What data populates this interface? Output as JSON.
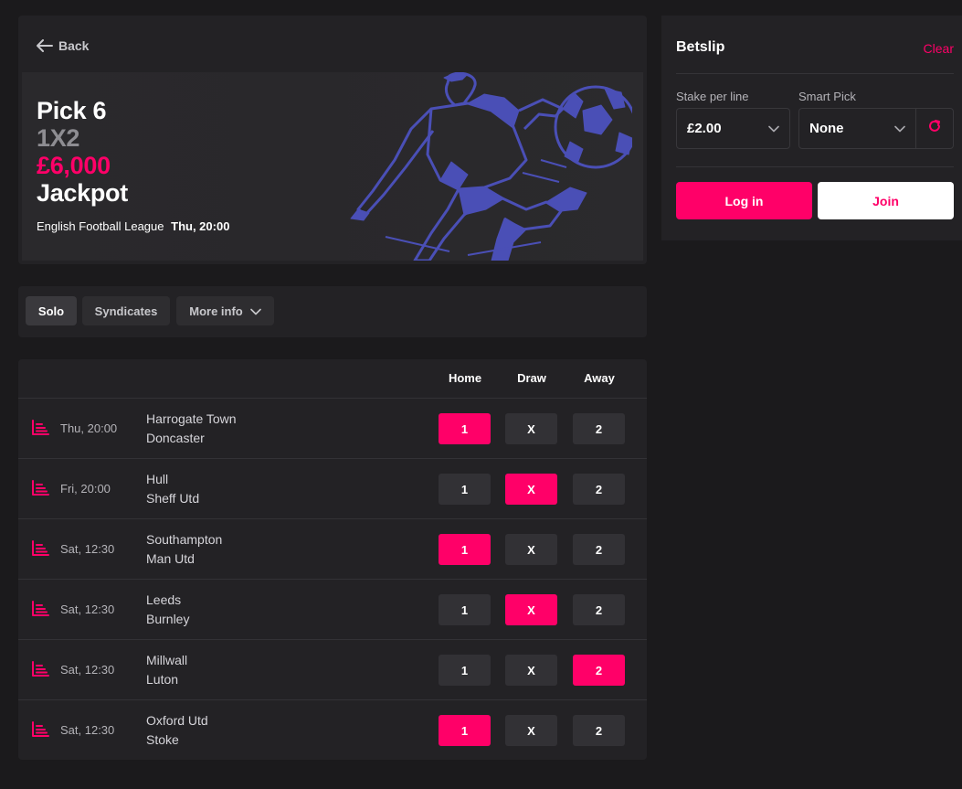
{
  "header": {
    "back_label": "Back"
  },
  "banner": {
    "title_line1": "Pick 6",
    "title_line2": "1X2",
    "title_line3": "£6,000",
    "title_line4": "Jackpot",
    "league": "English Football League",
    "kickoff": "Thu, 20:00"
  },
  "tabs": [
    {
      "label": "Solo",
      "active": true
    },
    {
      "label": "Syndicates",
      "active": false
    },
    {
      "label": "More info",
      "active": false
    }
  ],
  "columns": {
    "home": "Home",
    "draw": "Draw",
    "away": "Away"
  },
  "pick_labels": {
    "home": "1",
    "draw": "X",
    "away": "2"
  },
  "matches": [
    {
      "time": "Thu, 20:00",
      "home": "Harrogate Town",
      "away": "Doncaster",
      "selected": "home"
    },
    {
      "time": "Fri, 20:00",
      "home": "Hull",
      "away": "Sheff Utd",
      "selected": "draw"
    },
    {
      "time": "Sat, 12:30",
      "home": "Southampton",
      "away": "Man Utd",
      "selected": "home"
    },
    {
      "time": "Sat, 12:30",
      "home": "Leeds",
      "away": "Burnley",
      "selected": "draw"
    },
    {
      "time": "Sat, 12:30",
      "home": "Millwall",
      "away": "Luton",
      "selected": "away"
    },
    {
      "time": "Sat, 12:30",
      "home": "Oxford Utd",
      "away": "Stoke",
      "selected": "home"
    }
  ],
  "betslip": {
    "title": "Betslip",
    "clear_label": "Clear",
    "stake_label": "Stake per line",
    "stake_value": "£2.00",
    "smart_pick_label": "Smart Pick",
    "smart_pick_value": "None",
    "login_label": "Log in",
    "join_label": "Join"
  },
  "icons": {
    "back": "arrow-left-icon",
    "more_info": "chevron-down-icon",
    "stats": "stats-chart-icon",
    "refresh": "refresh-icon"
  },
  "colors": {
    "accent": "#ff0068",
    "panel": "#232225",
    "background": "#1b1a1c",
    "illustration": "#4a4fb6"
  }
}
